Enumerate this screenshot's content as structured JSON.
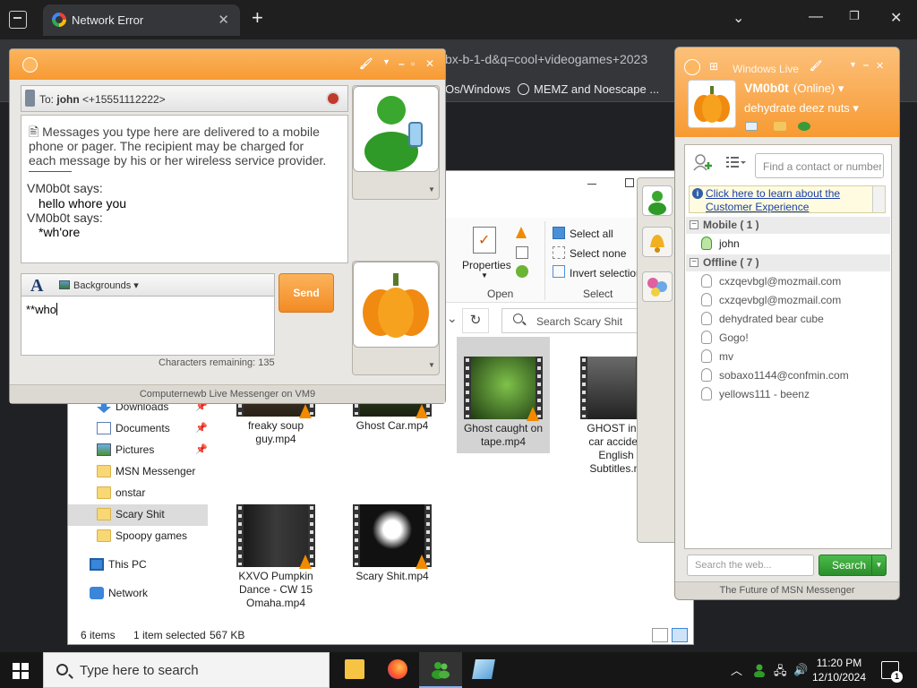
{
  "browser": {
    "tab_title": "Network Error",
    "url_fragment": "bx-b-1-d&q=cool+videogames+2023",
    "bookmarks": [
      "Os/Windows",
      "MEMZ and Noescape ..."
    ]
  },
  "explorer": {
    "ribbon": {
      "properties_label": "Properties",
      "open_group": "Open",
      "select_group": "Select",
      "select_all": "Select all",
      "select_none": "Select none",
      "invert_selection": "Invert selection"
    },
    "search_placeholder": "Search Scary Shit",
    "nav": [
      {
        "label": "Downloads",
        "pinned": true
      },
      {
        "label": "Documents",
        "pinned": true
      },
      {
        "label": "Pictures",
        "pinned": true
      },
      {
        "label": "MSN Messenger"
      },
      {
        "label": "onstar"
      },
      {
        "label": "Scary Shit",
        "selected": true
      },
      {
        "label": "Spoopy games"
      },
      {
        "label": "This PC"
      },
      {
        "label": "Network"
      }
    ],
    "files": [
      {
        "name": "freaky soup guy.mp4"
      },
      {
        "name": "Ghost Car.mp4"
      },
      {
        "name": "Ghost caught on tape.mp4",
        "selected": true
      },
      {
        "name": "GHOST in a car acciden English Subtitles.m"
      },
      {
        "name": "KXVO Pumpkin Dance - CW 15 Omaha.mp4"
      },
      {
        "name": "Scary Shit.mp4"
      }
    ],
    "status": {
      "item_count": "6 items",
      "selection": "1 item selected",
      "size": "567 KB"
    }
  },
  "conversation": {
    "to_prefix": "To:",
    "to_name": "john",
    "to_number": "<+15551112222>",
    "notice": "Messages you type here are delivered to a mobile phone or pager. The recipient may be charged for each message by his or her wireless service provider.",
    "messages": [
      {
        "sender": "VM0b0t says:",
        "text": "hello whore you"
      },
      {
        "sender": "VM0b0t says:",
        "text": "*wh'ore"
      }
    ],
    "backgrounds_label": "Backgrounds",
    "compose_text": "**who",
    "chars_remaining": "Characters remaining: 135",
    "send_label": "Send",
    "footer": "Computernewb Live Messenger on VM9"
  },
  "contact_list": {
    "brand": "Windows Live",
    "my_name": "VM0b0t",
    "my_status": "(Online)",
    "my_message": "dehydrate deez nuts",
    "find_placeholder": "Find a contact or number...",
    "ad_text": "Click here to learn about the Customer Experience",
    "groups": [
      {
        "label": "Mobile ( 1 )",
        "contacts": [
          "john"
        ]
      },
      {
        "label": "Offline ( 7 )",
        "contacts": [
          "cxzqevbgl@mozmail.com",
          "cxzqevbgl@mozmail.com",
          "dehydrated bear cube",
          "Gogo!",
          "mv",
          "sobaxo1144@confmin.com",
          "yellows111 - beenz"
        ]
      }
    ],
    "web_search_placeholder": "Search the web...",
    "search_label": "Search",
    "footer": "The Future of MSN Messenger"
  },
  "taskbar": {
    "search_placeholder": "Type here to search",
    "time": "11:20 PM",
    "date": "12/10/2024",
    "notification_count": "1"
  },
  "colors": {
    "msn_orange": "#f79a33",
    "search_green": "#2b8e2b",
    "link_blue": "#1a3fa6"
  }
}
